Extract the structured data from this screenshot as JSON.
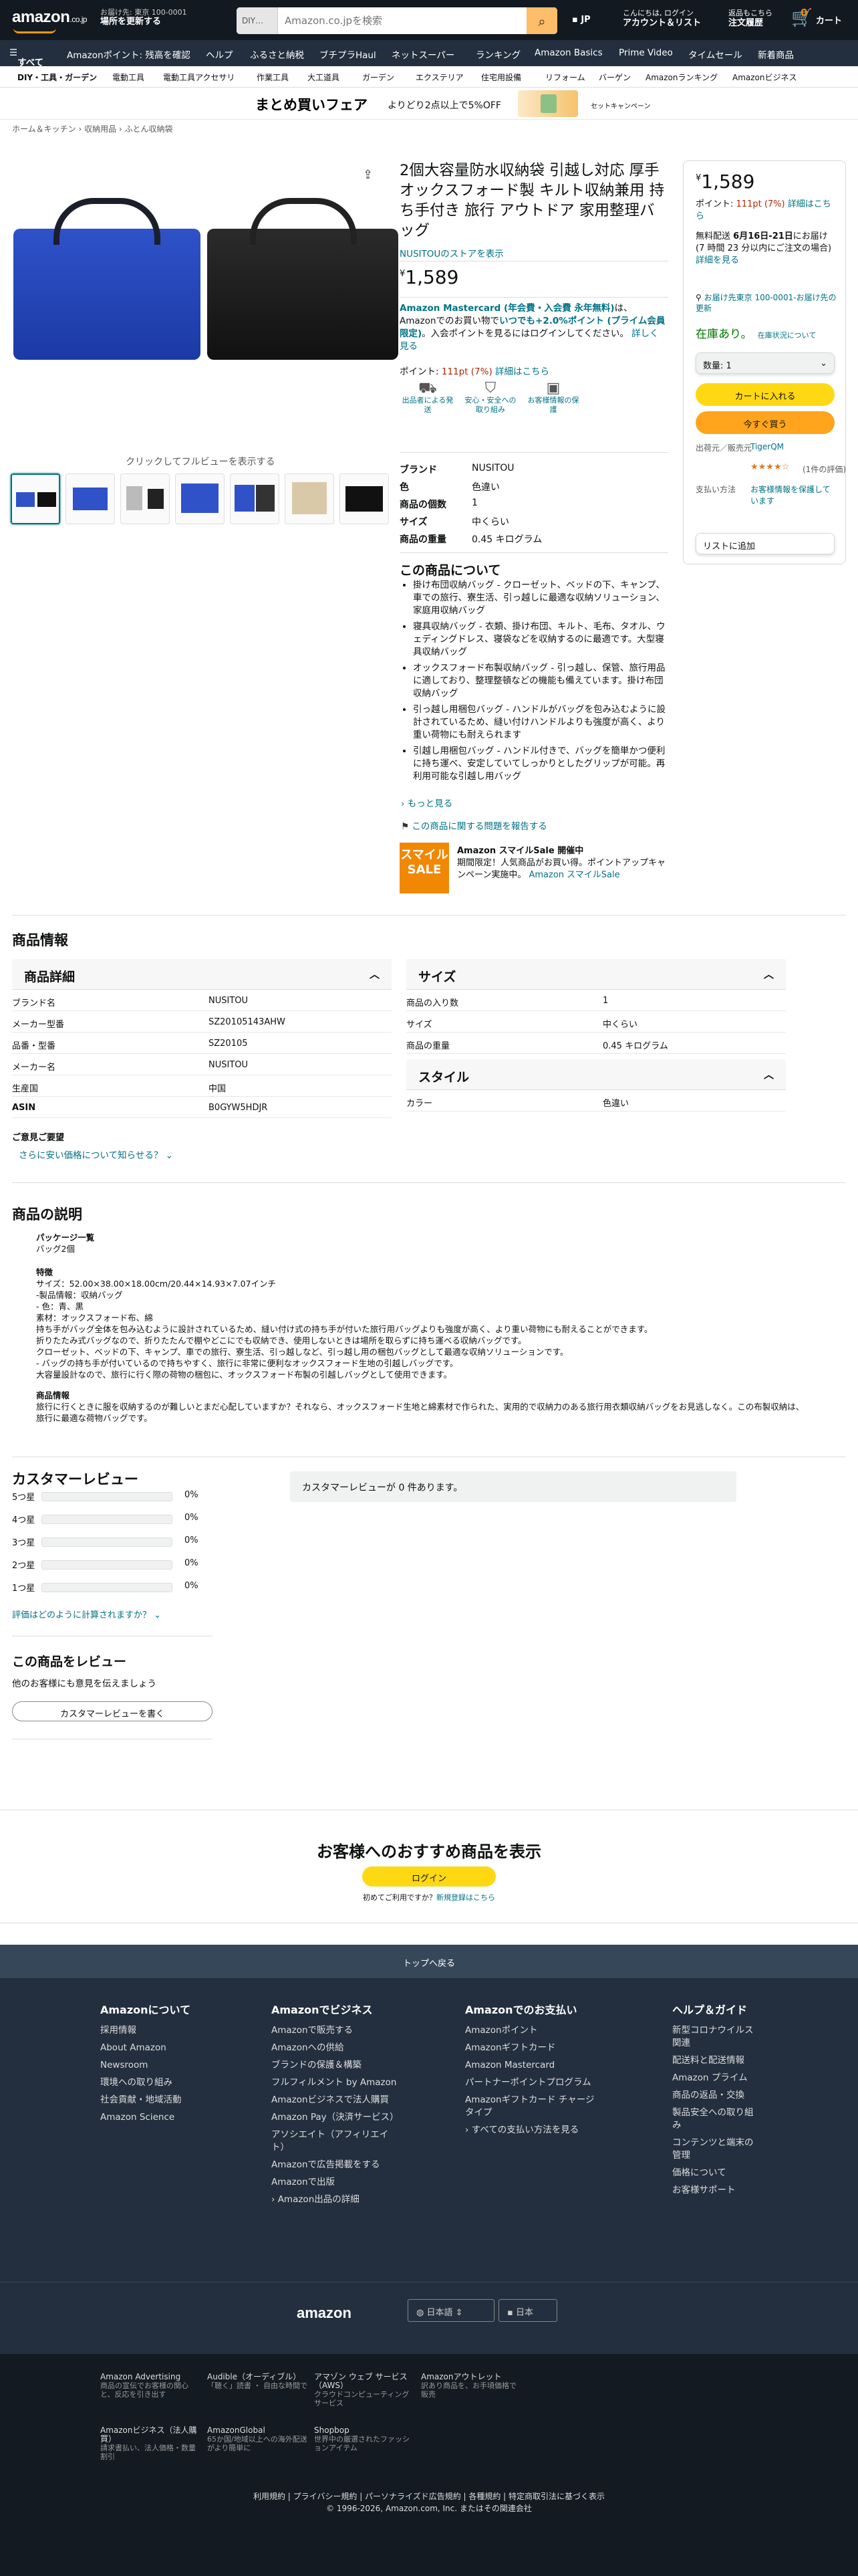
{
  "header": {
    "logo": "amazon",
    "logo_suffix": ".co.jp",
    "deliver_line1": "お届け先: 東京 100-0001",
    "deliver_line2": "場所を更新する",
    "search_category": "DIY…",
    "search_placeholder": "Amazon.co.jpを検索",
    "language": "JP",
    "account_line1": "こんにちは, ログイン",
    "account_line2": "アカウント＆リスト",
    "orders_line1": "返品もこちら",
    "orders_line2": "注文履歴",
    "cart_count": "0",
    "cart_label": "カート"
  },
  "nav_main": [
    "すべて",
    "Amazonポイント: 残高を確認",
    "ヘルプ",
    "ふるさと納税",
    "ブチプラHaul",
    "ネットスーパー",
    "ランキング",
    "Amazon Basics",
    "Prime Video",
    "タイムセール",
    "新着商品"
  ],
  "nav_sub": [
    "DIY・工具・ガーデン",
    "電動工具",
    "電動工具アクセサリ",
    "作業工具",
    "大工道具",
    "ガーデン",
    "エクステリア",
    "住宅用設備",
    "リフォーム",
    "バーゲン",
    "Amazonランキング",
    "Amazonビジネス"
  ],
  "banner": {
    "title": "まとめ買いフェア",
    "subtitle": "よりどり2点以上で5%OFF",
    "link": "セットキャンペーン"
  },
  "breadcrumb": "ホーム＆キッチン › 収納用品 › ふとん収納袋",
  "gallery": {
    "zoom_hint": "クリックしてフルビューを表示する"
  },
  "product": {
    "title": "2個大容量防水収納袋 引越し対応 厚手オックスフォード製 キルト収納兼用 持ち手付き 旅行 アウトドア 家用整理バッグ",
    "store": "NUSITOUのストアを表示",
    "price_symbol": "¥",
    "price": "1,589",
    "mastercard_bold": "Amazon Mastercard (年会費・入会費 永年無料)",
    "mastercard_rest": "は、Amazonでのお買い物で",
    "mastercard_bold2": "いつでも+2.0%ポイント (プライム会員 限定)",
    "mastercard_rest2": "。入会ポイントを見るにはログインしてください。",
    "mastercard_link": "詳しく見る",
    "points_label": "ポイント:",
    "points_value": "111pt",
    "points_pct": "(7%)",
    "points_link": "詳細はこちら",
    "icons": [
      {
        "icon": "truck-icon",
        "label": "出品者による発送"
      },
      {
        "icon": "shield-icon",
        "label": "安心・安全への取り組み"
      },
      {
        "icon": "box-icon",
        "label": "お客様情報の保護"
      }
    ],
    "specs": [
      {
        "k": "ブランド",
        "v": "NUSITOU"
      },
      {
        "k": "色",
        "v": "色違い"
      },
      {
        "k": "商品の個数",
        "v": "1"
      },
      {
        "k": "サイズ",
        "v": "中くらい"
      },
      {
        "k": "商品の重量",
        "v": "0.45 キログラム"
      }
    ],
    "about_heading": "この商品について",
    "bullets": [
      "掛け布団収納バッグ - クローゼット、ベッドの下、キャンプ、車での旅行、寮生活、引っ越しに最適な収納ソリューション、家庭用収納バッグ",
      "寝具収納バッグ - 衣類、掛け布団、キルト、毛布、タオル、ウェディングドレス、寝袋などを収納するのに最適です。大型寝具収納バッグ",
      "オックスフォード布製収納バッグ - 引っ越し、保管、旅行用品に適しており、整理整頓などの機能も備えています。掛け布団収納バッグ",
      "引っ越し用梱包バッグ - ハンドルがバッグを包み込むように設計されているため、縫い付けハンドルよりも強度が高く、より重い荷物にも耐えられます",
      "引越し用梱包バッグ - ハンドル付きで、バッグを簡単かつ便利に持ち運べ、安定していてしっかりとしたグリップが可能。再利用可能な引越し用バッグ"
    ],
    "more": "もっと見る",
    "report": "この商品に関する問題を報告する",
    "sale_logo": "スマイル SALE",
    "sale_title": "Amazon スマイルSale 開催中",
    "sale_text": "期間限定！人気商品がお買い得。ポイントアップキャンペーン実施中。",
    "sale_link": "Amazon スマイルSale"
  },
  "buybox": {
    "price_symbol": "¥",
    "price": "1,589",
    "points_label": "ポイント:",
    "points_value": "111pt",
    "points_pct": "(7%)",
    "points_link": "詳細はこちら",
    "delivery_prefix": "無料配送",
    "delivery_date": "6月16日-21日",
    "delivery_suffix": "にお届け",
    "delivery_note": "(7 時間 23 分以内にご注文の場合)",
    "delivery_link": "詳細を見る",
    "location": "お届け先東京 100-0001-お届け先の更新",
    "stock": "在庫あり。",
    "stock_note": "在庫状況について",
    "quantity": "数量: 1",
    "add_to_cart": "カートに入れる",
    "buy_now": "今すぐ買う",
    "ship_from_label": "出荷元／販売元",
    "ship_from_value": "TigerQM",
    "rating_text": "(1件の評価)",
    "payment_label": "支払い方法",
    "payment_value": "お客様情報を保護しています",
    "wishlist": "リストに追加"
  },
  "product_info": {
    "heading": "商品情報",
    "details_heading": "商品詳細",
    "details": [
      {
        "k": "ブランド名",
        "v": "NUSITOU"
      },
      {
        "k": "メーカー型番",
        "v": "SZ20105143AHW"
      },
      {
        "k": "品番・型番",
        "v": "SZ20105"
      },
      {
        "k": "メーカー名",
        "v": "NUSITOU"
      },
      {
        "k": "生産国",
        "v": "中国"
      },
      {
        "k": "ASIN",
        "v": "B0GYW5HDJR"
      }
    ],
    "size_heading": "サイズ",
    "size": [
      {
        "k": "商品の入り数",
        "v": "1"
      },
      {
        "k": "サイズ",
        "v": "中くらい"
      },
      {
        "k": "商品の重量",
        "v": "0.45 キログラム"
      }
    ],
    "style_heading": "スタイル",
    "style": [
      {
        "k": "カラー",
        "v": "色違い"
      }
    ],
    "feedback_heading": "ご意見ご要望",
    "feedback_link": "さらに安い価格について知らせる？"
  },
  "description": {
    "heading": "商品の説明",
    "package_title": "パッケージ一覧",
    "package_text": "バッグ2個",
    "feature_title": "特徴",
    "feature_lines": [
      "サイズ：52.00×38.00×18.00cm/20.44×14.93×7.07インチ",
      "-製品情報：収納バッグ",
      "- 色：青、黒",
      "素材：オックスフォード布、綿",
      "持ち手がバッグ全体を包み込むように設計されているため、縫い付け式の持ち手が付いた旅行用バッグよりも強度が高く、より重い荷物にも耐えることができます。",
      "折りたたみ式バッグなので、折りたたんで棚やどこにでも収納でき、使用しないときは場所を取らずに持ち運べる収納バッグです。",
      "クローゼット、ベッドの下、キャンプ、車での旅行、寮生活、引っ越しなど、引っ越し用の梱包バッグとして最適な収納ソリューションです。",
      "- バッグの持ち手が付いているので持ちやすく、旅行に非常に便利なオックスフォード生地の引越しバッグです。",
      "大容量設計なので、旅行に行く際の荷物の梱包に、オックスフォード布製の引越しバッグとして使用できます。"
    ],
    "info_title": "商品情報",
    "info_text": "旅行に行くときに服を収納するのが難しいとまだ心配していますか？それなら、オックスフォード生地と綿素材で作られた、実用的で収納力のある旅行用衣類収納バッグをお見逃しなく。この布製収納は、旅行に最適な荷物バッグです。"
  },
  "reviews": {
    "heading": "カスタマーレビュー",
    "rows": [
      {
        "label": "5つ星",
        "pct": "0%"
      },
      {
        "label": "4つ星",
        "pct": "0%"
      },
      {
        "label": "3つ星",
        "pct": "0%"
      },
      {
        "label": "2つ星",
        "pct": "0%"
      },
      {
        "label": "1つ星",
        "pct": "0%"
      }
    ],
    "how_link": "評価はどのように計算されますか？",
    "empty": "カスタマーレビューが 0 件あります。",
    "write_heading": "この商品をレビュー",
    "write_sub": "他のお客様にも意見を伝えましょう",
    "write_button": "カスタマーレビューを書く"
  },
  "signin": {
    "heading": "お客様へのおすすめ商品を表示",
    "button": "ログイン",
    "sub_prefix": "初めてご利用ですか？",
    "sub_link": "新規登録はこちら"
  },
  "footer": {
    "back_to_top": "トップへ戻る",
    "columns": [
      {
        "h": "Amazonについて",
        "items": [
          "採用情報",
          "About Amazon",
          "Newsroom",
          "環境への取り組み",
          "社会貢献・地域活動",
          "Amazon Science"
        ]
      },
      {
        "h": "Amazonでビジネス",
        "items": [
          "Amazonで販売する",
          "Amazonへの供給",
          "ブランドの保護＆構築",
          "フルフィルメント by Amazon",
          "Amazonビジネスで法人購買",
          "Amazon Pay（決済サービス）",
          "アソシエイト（アフィリエイト）",
          "Amazonで広告掲載をする",
          "Amazonで出版",
          "› Amazon出品の詳細"
        ]
      },
      {
        "h": "Amazonでのお支払い",
        "items": [
          "Amazonポイント",
          "Amazonギフトカード",
          "Amazon Mastercard",
          "パートナーポイントプログラム",
          "Amazonギフトカード チャージタイプ",
          "› すべての支払い方法を見る"
        ]
      },
      {
        "h": "ヘルプ＆ガイド",
        "items": [
          "新型コロナウイルス関連",
          "配送料と配送情報",
          "Amazon プライム",
          "商品の返品・交換",
          "製品安全への取り組み",
          "コンテンツと端末の管理",
          "価格について",
          "お客様サポート"
        ]
      }
    ],
    "logo": "amazon",
    "language_select": "日本語",
    "country_select": "日本",
    "services": [
      {
        "t": "Amazon Advertising",
        "s": "商品の宣伝でお客様の関心と、反応を引き出す"
      },
      {
        "t": "Audible（オーディブル）",
        "s": "「聴く」読書 ・ 自由な時間で"
      },
      {
        "t": "アマゾン ウェブ サービス（AWS）",
        "s": "クラウドコンピューティングサービス"
      },
      {
        "t": "Amazonアウトレット",
        "s": "訳あり商品を、お手頃価格で販売"
      },
      {
        "t": "Amazonビジネス（法人購買）",
        "s": "請求書払い、法人価格・数量割引"
      },
      {
        "t": "AmazonGlobal",
        "s": "65か国/地域以上への海外配送がより簡単に"
      },
      {
        "t": "Shopbop",
        "s": "世界中の厳選されたファッションアイテム"
      }
    ],
    "legal_links": "利用規約 | プライバシー規約 | パーソナライズド広告規約 | 各種規約 | 特定商取引法に基づく表示",
    "copyright": "© 1996-2026, Amazon.com, Inc. またはその関連会社"
  }
}
